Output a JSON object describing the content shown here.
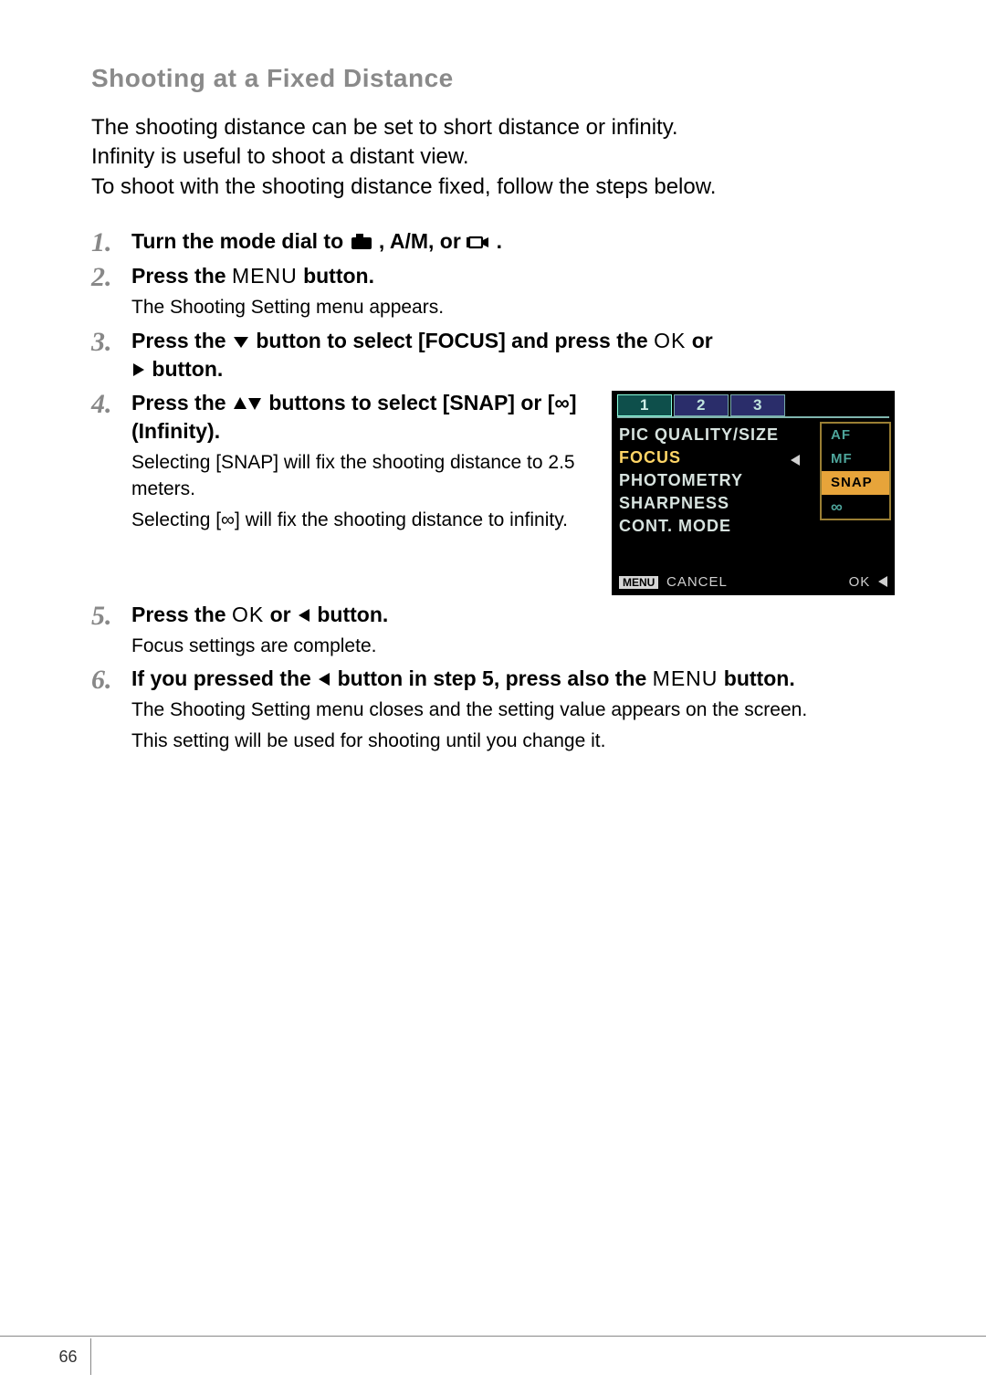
{
  "title": "Shooting at a Fixed Distance",
  "intro": {
    "l1": "The shooting distance can be set to short distance or infinity.",
    "l2": "Infinity is useful to shoot a distant view.",
    "l3": "To shoot with the shooting distance fixed, follow the steps below."
  },
  "steps": {
    "s1": {
      "num": "1.",
      "pre": "Turn the mode dial to ",
      "mid": ", A/M, or ",
      "post": " ."
    },
    "s2": {
      "num": "2.",
      "pre": "Press the ",
      "menu": "MENU",
      "post": " button.",
      "sub": "The Shooting Setting menu appears."
    },
    "s3": {
      "num": "3.",
      "pre": "Press the ",
      "mid": " button to select [FOCUS] and press the ",
      "ok": "OK",
      "post1": " or ",
      "post2": " button."
    },
    "s4": {
      "num": "4.",
      "pre": "Press the ",
      "mid": " buttons to select [SNAP] or [",
      "inf": "∞",
      "post": "] (Infinity).",
      "sub1": "Selecting [SNAP] will fix the shooting distance to 2.5 meters.",
      "sub2": "Selecting [∞] will fix the shooting distance to infinity."
    },
    "s5": {
      "num": "5.",
      "pre": "Press the ",
      "ok": "OK",
      "mid": " or ",
      "post": " button.",
      "sub": "Focus settings are complete."
    },
    "s6": {
      "num": "6.",
      "pre": "If you pressed the ",
      "mid": " button in step 5, press also the ",
      "menu": "MENU",
      "post": " button.",
      "sub1": "The Shooting Setting menu closes and the setting value appears on the screen.",
      "sub2": "This setting will be used for shooting until you change it."
    }
  },
  "lcd": {
    "tabs": [
      "1",
      "2",
      "3"
    ],
    "rows": [
      "PIC QUALITY/SIZE",
      "FOCUS",
      "PHOTOMETRY",
      "SHARPNESS",
      "CONT. MODE"
    ],
    "options": [
      "AF",
      "MF",
      "SNAP",
      "∞"
    ],
    "menu_label": "MENU",
    "cancel": "CANCEL",
    "ok": "OK"
  },
  "page_number": "66"
}
